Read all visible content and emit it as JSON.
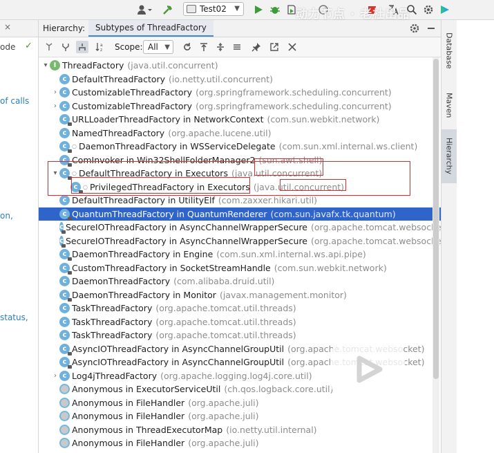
{
  "toolbar": {
    "run_config": "Test02",
    "icons": [
      "user-icon",
      "build-hammer-icon",
      "run-icon",
      "debug-icon",
      "coverage-icon",
      "profile-icon",
      "stop-icon",
      "translate-icon",
      "search-icon",
      "settings-icon",
      "toolbox-icon"
    ]
  },
  "left_pane": {
    "snippets": [
      "ode",
      "of calls",
      "on,",
      "status,"
    ]
  },
  "hierarchy": {
    "title": "Hierarchy:",
    "tab_label": "Subtypes of ThreadFactory",
    "scope_label": "Scope:",
    "scope_value": "All",
    "rows": [
      {
        "name": "ThreadFactory",
        "pkg": "(java.util.concurrent)"
      },
      {
        "name": "DefaultThreadFactory",
        "pkg": "(io.netty.util.concurrent)"
      },
      {
        "name": "CustomizableThreadFactory",
        "pkg": "(org.springframework.scheduling.concurrent)"
      },
      {
        "name": "CustomizableThreadFactory",
        "pkg": "(org.springframework.scheduling.concurrent)"
      },
      {
        "name": "URLLoaderThreadFactory in NetworkContext",
        "pkg": "(com.sun.webkit.network)"
      },
      {
        "name": "NamedThreadFactory",
        "pkg": "(org.apache.lucene.util)"
      },
      {
        "name": "DaemonThreadFactory in WSServiceDelegate",
        "pkg": "(com.sun.xml.internal.ws.client)"
      },
      {
        "name": "ComInvoker in Win32ShellFolderManager2",
        "pkg": "(sun.awt.shell)"
      },
      {
        "name": "DefaultThreadFactory in Executors",
        "pkg": "(java.util.concurrent)"
      },
      {
        "name": "PrivilegedThreadFactory in Executors",
        "pkg": "(java.util.concurrent)"
      },
      {
        "name": "DefaultThreadFactory in UtilityElf",
        "pkg": "(com.zaxxer.hikari.util)"
      },
      {
        "name": "QuantumThreadFactory in QuantumRenderer",
        "pkg": "(com.sun.javafx.tk.quantum)"
      },
      {
        "name": "SecureIOThreadFactory in AsyncChannelWrapperSecure",
        "pkg": "(org.apache.tomcat.websocket"
      },
      {
        "name": "SecureIOThreadFactory in AsyncChannelWrapperSecure",
        "pkg": "(org.apache.tomcat.websocket"
      },
      {
        "name": "DaemonThreadFactory in Engine",
        "pkg": "(com.sun.xml.internal.ws.api.pipe)"
      },
      {
        "name": "CustomThreadFactory in SocketStreamHandle",
        "pkg": "(com.sun.webkit.network)"
      },
      {
        "name": "DaemonThreadFactory",
        "pkg": "(com.alibaba.druid.util)"
      },
      {
        "name": "DaemonThreadFactory in Monitor",
        "pkg": "(javax.management.monitor)"
      },
      {
        "name": "TaskThreadFactory",
        "pkg": "(org.apache.tomcat.util.threads)"
      },
      {
        "name": "TaskThreadFactory",
        "pkg": "(org.apache.tomcat.util.threads)"
      },
      {
        "name": "TaskThreadFactory",
        "pkg": "(org.apache.tomcat.util.threads)"
      },
      {
        "name": "AsyncIOThreadFactory in AsyncChannelGroupUtil",
        "pkg": "(org.apache.tomcat.websocket)"
      },
      {
        "name": "AsyncIOThreadFactory in AsyncChannelGroupUtil",
        "pkg": "(org.apache.tomcat.websocket)"
      },
      {
        "name": "Log4jThreadFactory",
        "pkg": "(org.apache.logging.log4j.core.util)"
      },
      {
        "name": "Anonymous in ExecutorServiceUtil",
        "pkg": "(ch.qos.logback.core.util)"
      },
      {
        "name": "Anonymous in FileHandler",
        "pkg": "(org.apache.juli)"
      },
      {
        "name": "Anonymous in FileHandler",
        "pkg": "(org.apache.juli)"
      },
      {
        "name": "Anonymous in ThreadExecutorMap",
        "pkg": "(io.netty.util.internal)"
      },
      {
        "name": "Anonymous in FileHandler",
        "pkg": "(org.apache.juli)"
      }
    ]
  },
  "right_strip": {
    "tabs": [
      "Database",
      "Maven",
      "Hierarchy"
    ]
  },
  "watermark": {
    "text": "动力节点 · 老杜出品"
  },
  "colors": {
    "selection": "#2f65ca",
    "class_icon": "#6fb1dc",
    "annotation": "#e02a2a",
    "package_text": "#8c8c8c"
  }
}
